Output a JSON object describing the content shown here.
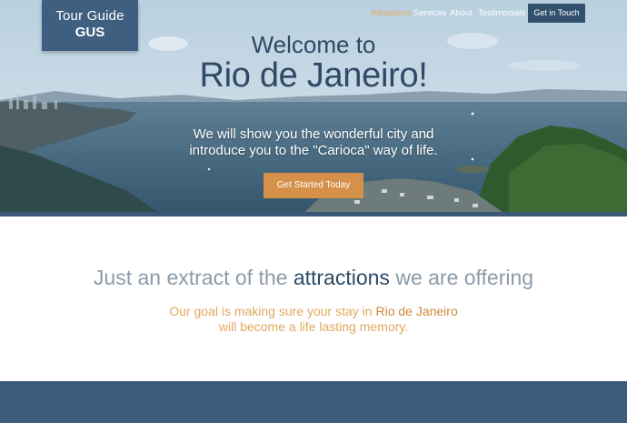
{
  "brand": {
    "line1": "Tour Guide",
    "line2": "GUS"
  },
  "nav": {
    "items": [
      {
        "label": "Attractions",
        "active": true
      },
      {
        "label": "Services",
        "active": false
      },
      {
        "label": "About",
        "active": false
      },
      {
        "label": "Testimonials",
        "active": false
      }
    ],
    "cta_label": "Get in Touch"
  },
  "hero": {
    "welcome": "Welcome to",
    "city": "Rio de Janeiro!",
    "tagline_line1": "We will show you the wonderful city and",
    "tagline_line2": "introduce you to the \"Carioca\" way of life.",
    "button_label": "Get Started Today"
  },
  "section": {
    "title_pre": "Just an extract of the",
    "title_strong": "attractions",
    "title_post": "we are offering",
    "sub_pre": "Our goal is making sure your stay in",
    "sub_strong": "Rio de Janeiro",
    "sub_line2": "will become a life lasting memory."
  },
  "colors": {
    "primary": "#3e5f80",
    "accent": "#d5904a",
    "nav_active": "#e7ab5a",
    "footer": "#3d5b7d"
  }
}
